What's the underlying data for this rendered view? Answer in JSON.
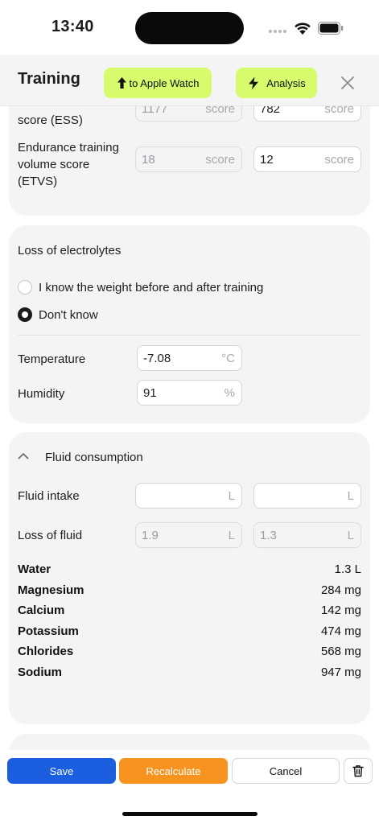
{
  "status_bar": {
    "time": "13:40"
  },
  "header": {
    "title": "Training",
    "watch_button": "to Apple Watch",
    "analysis_button": "Analysis"
  },
  "scores_card": {
    "ess_label_partial": "score (ESS)",
    "ess_value_1": "1177",
    "ess_value_2": "782",
    "ess_unit": "score",
    "etvs_label": "Endurance training volume score (ETVS)",
    "etvs_value_1": "18",
    "etvs_value_2": "12",
    "etvs_unit": "score"
  },
  "electrolytes_card": {
    "title": "Loss of electrolytes",
    "options": [
      "I know the weight before and after training",
      "Don't know"
    ],
    "selected_option": "Don't know",
    "temperature_label": "Temperature",
    "temperature_value": "-7.08",
    "temperature_unit": "°C",
    "humidity_label": "Humidity",
    "humidity_value": "91",
    "humidity_unit": "%"
  },
  "fluid_card": {
    "title": "Fluid consumption",
    "intake_label": "Fluid intake",
    "intake_value_1": "",
    "intake_value_2": "",
    "unit": "L",
    "loss_label": "Loss of fluid",
    "loss_value_1": "1.9",
    "loss_value_2": "1.3",
    "nutrients": [
      {
        "name": "Water",
        "value": "1.3 L"
      },
      {
        "name": "Magnesium",
        "value": "284 mg"
      },
      {
        "name": "Calcium",
        "value": "142 mg"
      },
      {
        "name": "Potassium",
        "value": "474 mg"
      },
      {
        "name": "Chlorides",
        "value": "568 mg"
      },
      {
        "name": "Sodium",
        "value": "947 mg"
      }
    ]
  },
  "actions": {
    "save": "Save",
    "recalculate": "Recalculate",
    "cancel": "Cancel"
  },
  "colors": {
    "pill_green": "#d6fb6c",
    "save_blue": "#1b5fe0",
    "recalc_orange": "#f7931e",
    "card_bg": "#f4f4f5"
  },
  "icons": {
    "watch_button": "arrow-up-icon",
    "analysis_button": "lightning-icon",
    "close": "close-icon",
    "collapse": "chevron-up-icon",
    "trash": "trash-icon"
  }
}
